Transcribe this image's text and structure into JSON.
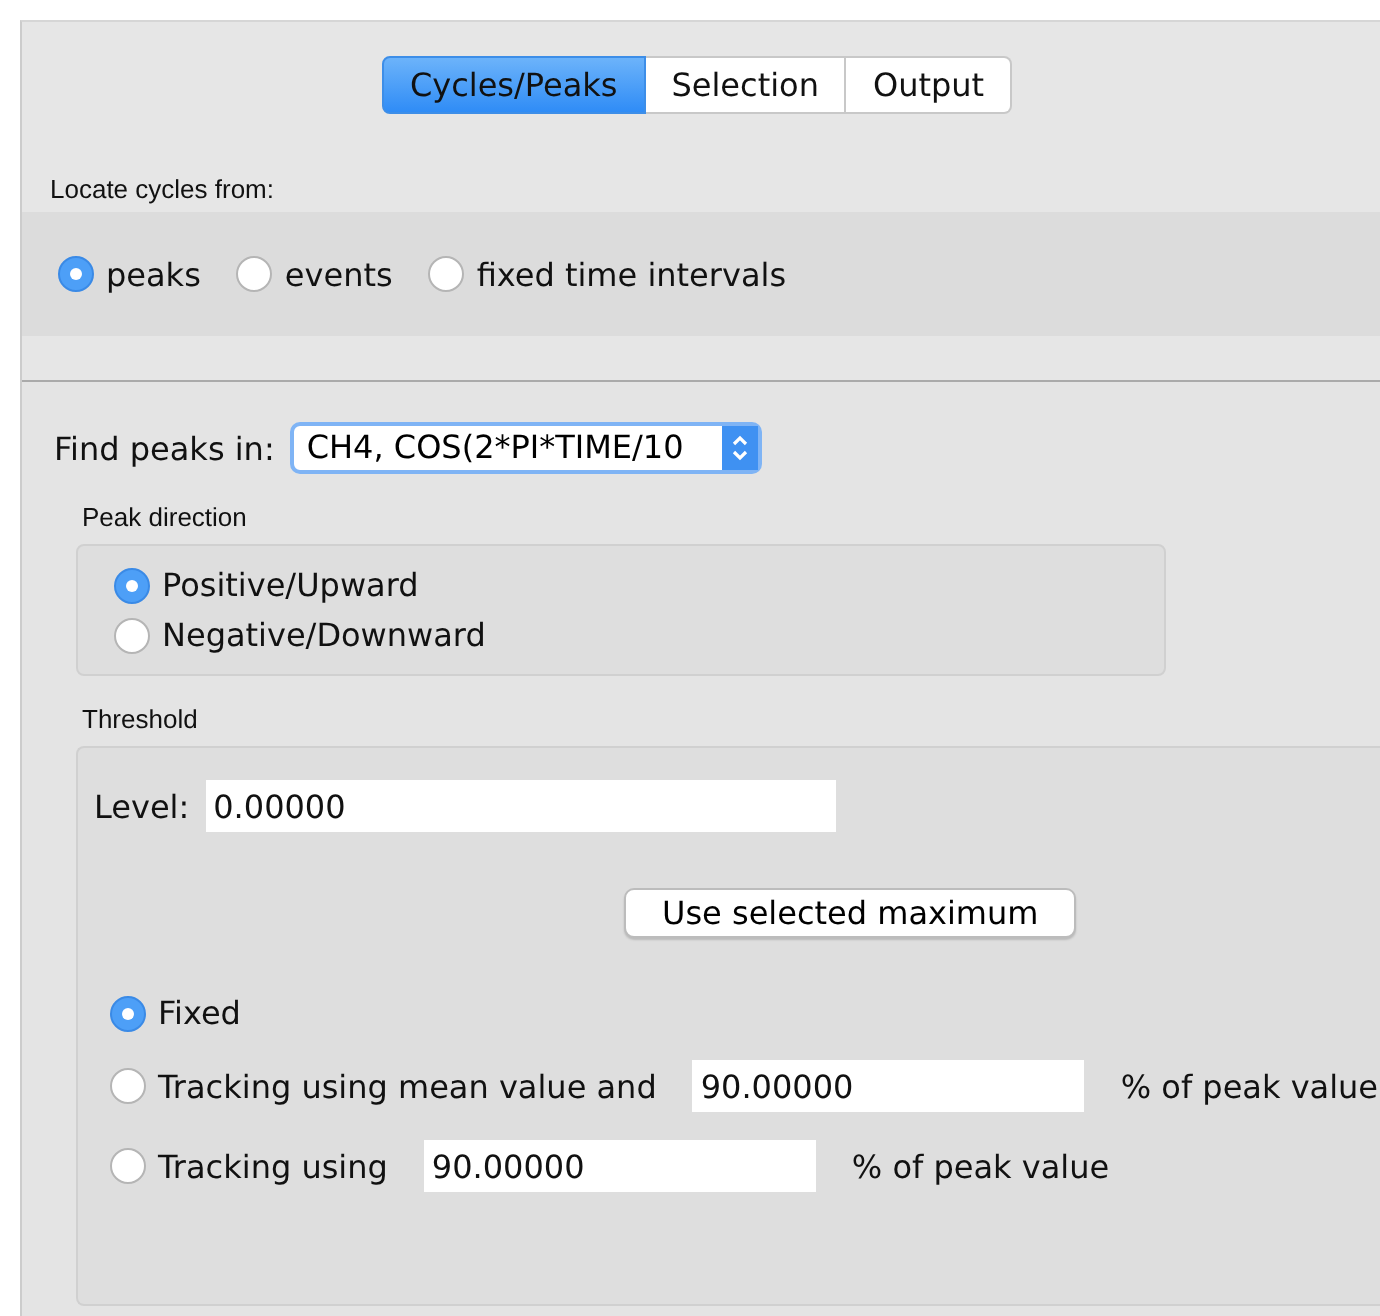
{
  "tabs": [
    {
      "label": "Cycles/Peaks",
      "selected": true
    },
    {
      "label": "Selection",
      "selected": false
    },
    {
      "label": "Output",
      "selected": false
    }
  ],
  "locate": {
    "label": "Locate cycles from:",
    "options": [
      {
        "label": "peaks",
        "selected": true
      },
      {
        "label": "events",
        "selected": false
      },
      {
        "label": "fixed time intervals",
        "selected": false
      }
    ]
  },
  "find_peaks": {
    "label": "Find peaks in:",
    "value": "CH4, COS(2*PI*TIME/10"
  },
  "peak_direction": {
    "title": "Peak direction",
    "options": [
      {
        "label": "Positive/Upward",
        "selected": true
      },
      {
        "label": "Negative/Downward",
        "selected": false
      }
    ]
  },
  "threshold": {
    "title": "Threshold",
    "level_label": "Level:",
    "level_value": "0.00000",
    "button": "Use selected maximum",
    "modes": [
      {
        "kind": "plain",
        "label": "Fixed",
        "selected": true
      },
      {
        "kind": "field",
        "label": "Tracking using mean value and",
        "value": "90.00000",
        "suffix": "% of peak value",
        "selected": false
      },
      {
        "kind": "field",
        "label": "Tracking using",
        "value": "90.00000",
        "suffix": "% of peak value",
        "selected": false
      }
    ]
  }
}
